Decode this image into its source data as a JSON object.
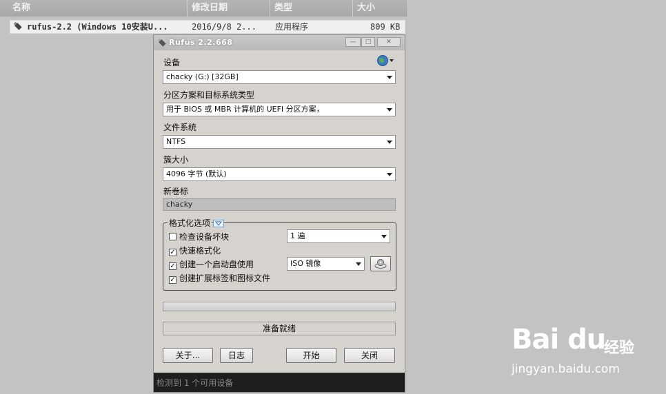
{
  "explorer": {
    "columns": [
      "名称",
      "修改日期",
      "类型",
      "大小"
    ],
    "file": {
      "name": "rufus-2.2 (Windows 10安装U...",
      "modified": "2016/9/8 2...",
      "type": "应用程序",
      "size": "809 KB"
    }
  },
  "dialog": {
    "title": "Rufus 2.2.668",
    "device_label": "设备",
    "device_value": "chacky (G:) [32GB]",
    "partition_label": "分区方案和目标系统类型",
    "partition_value": "用于 BIOS 或 MBR 计算机的 UEFI 分区方案，",
    "fs_label": "文件系统",
    "fs_value": "NTFS",
    "cluster_label": "簇大小",
    "cluster_value": "4096 字节 (默认)",
    "volume_label": "新卷标",
    "volume_value": "chacky",
    "format_options": {
      "legend": "格式化选项",
      "check_bad_blocks": {
        "label": "检查设备坏块",
        "checked": false
      },
      "passes_value": "1 遍",
      "quick_format": {
        "label": "快速格式化",
        "checked": true
      },
      "create_bootable": {
        "label": "创建一个启动盘使用",
        "checked": true
      },
      "boot_type_value": "ISO 镜像",
      "extended_label": {
        "label": "创建扩展标签和图标文件",
        "checked": true
      }
    },
    "status_text": "准备就绪",
    "buttons": {
      "about": "关于...",
      "log": "日志",
      "start": "开始",
      "close": "关闭"
    },
    "statusbar": "检测到 1 个可用设备"
  },
  "watermark": {
    "brand": "Bai du",
    "suffix": "经验",
    "url": "jingyan.baidu.com"
  }
}
